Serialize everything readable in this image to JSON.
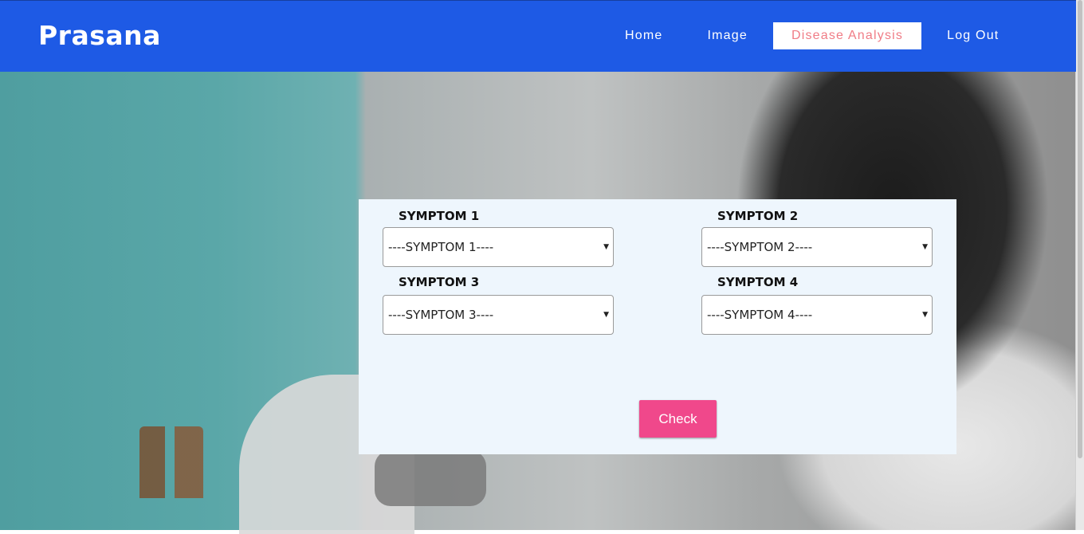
{
  "header": {
    "brand": "Prasana",
    "nav": [
      {
        "label": "Home"
      },
      {
        "label": "Image"
      },
      {
        "label": "Disease Analysis",
        "active": true
      },
      {
        "label": "Log Out"
      }
    ]
  },
  "form": {
    "fields": [
      {
        "label": "SYMPTOM 1",
        "value": "----SYMPTOM 1----"
      },
      {
        "label": "SYMPTOM 2",
        "value": "----SYMPTOM 2----"
      },
      {
        "label": "SYMPTOM 3",
        "value": "----SYMPTOM 3----"
      },
      {
        "label": "SYMPTOM 4",
        "value": "----SYMPTOM 4----"
      }
    ],
    "check_label": "Check"
  },
  "colors": {
    "header_bg": "#1e5ae5",
    "active_nav_text": "#f07c86",
    "button_bg": "#f0488b",
    "panel_bg": "#eef6fd"
  },
  "icons": {
    "select_caret": "triangle-down-icon"
  }
}
